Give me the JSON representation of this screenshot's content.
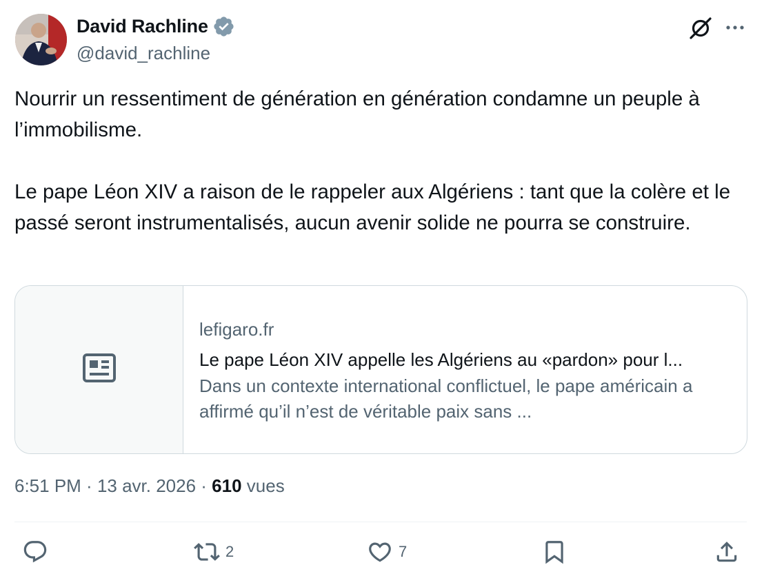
{
  "author": {
    "name": "David Rachline",
    "handle": "@david_rachline"
  },
  "tweet": {
    "text": "Nourrir un ressentiment de génération en génération condamne un peuple à l’immobilisme.\n\nLe pape Léon XIV a raison de le rappeler aux Algériens : tant que la colère et le passé seront instrumentalisés, aucun avenir solide ne pourra se construire."
  },
  "card": {
    "domain": "lefigaro.fr",
    "title": "Le pape Léon XIV appelle les Algériens au «pardon» pour l...",
    "description": "Dans un contexte international conflictuel, le pape américain a affirmé qu’il n’est de véritable paix sans ..."
  },
  "meta": {
    "time": "6:51 PM",
    "sep1": " · ",
    "date": "13 avr. 2026",
    "sep2": " · ",
    "views": "610",
    "views_label": " vues"
  },
  "actions": {
    "retweets": "2",
    "likes": "7"
  },
  "icons": [
    "avatar",
    "verified-badge-icon",
    "grok-icon",
    "more-icon",
    "news-icon",
    "reply-icon",
    "retweet-icon",
    "like-icon",
    "bookmark-icon",
    "share-icon"
  ],
  "colors": {
    "text": "#0f1419",
    "secondary": "#536471",
    "border": "#cfd9de",
    "verified": "#829aab"
  }
}
